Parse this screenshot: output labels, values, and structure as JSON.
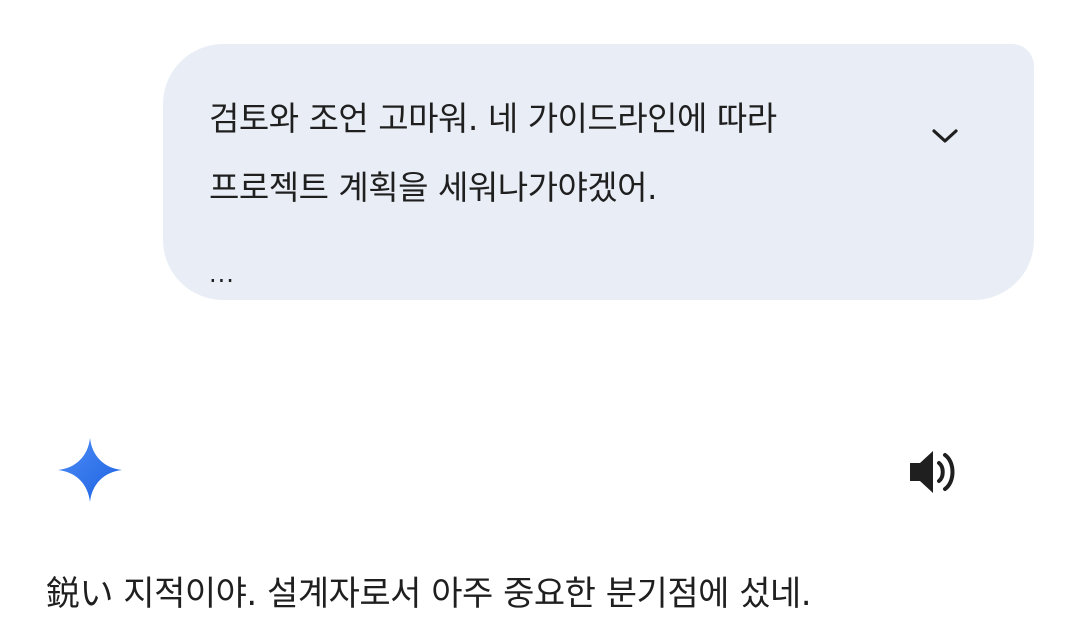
{
  "conversation": {
    "user_message": {
      "lines": [
        "검토와 조언 고마워. 네 가이드라인에 따라",
        "프로젝트 계획을 세워나가야겠어."
      ],
      "truncation": "...",
      "expand_icon": "chevron-down-icon"
    },
    "assistant_message": {
      "avatar_icon": "gemini-sparkle-icon",
      "speaker_icon": "speaker-icon",
      "text": "鋭い 지적이야. 설계자로서 아주 중요한 분기점에 섰네."
    }
  },
  "colors": {
    "user_bubble_bg": "#e9eef6",
    "text": "#1f1f1f",
    "sparkle_gradient_start": "#4f8ff7",
    "sparkle_gradient_end": "#1a5fe0",
    "icon": "#444746"
  }
}
